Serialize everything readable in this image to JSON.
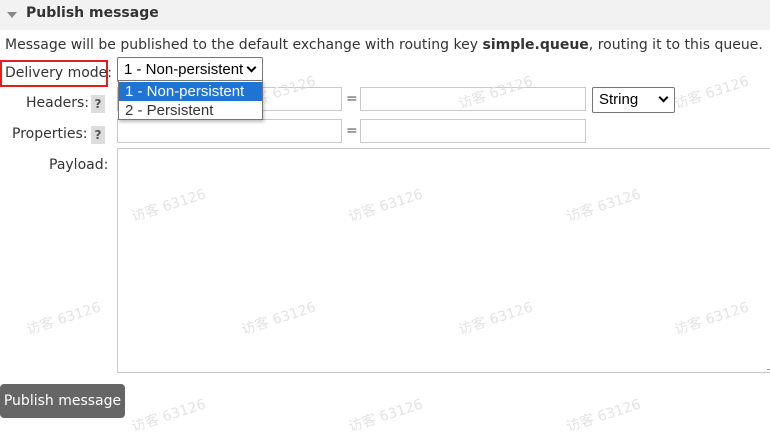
{
  "section": {
    "title": "Publish message"
  },
  "info": {
    "prefix": "Message will be published to the default exchange with routing key ",
    "routing_key": "simple.queue",
    "suffix": ", routing it to this queue."
  },
  "form": {
    "delivery_mode_label": "Delivery mode:",
    "delivery_mode_selected": "1 - Non-persistent",
    "delivery_mode_options": [
      "1 - Non-persistent",
      "2 - Persistent"
    ],
    "headers_label": "Headers:",
    "properties_label": "Properties:",
    "payload_label": "Payload:",
    "help_mark": "?",
    "equals": "=",
    "header_type_selected": "String"
  },
  "publish_button_label": "Publish message",
  "watermark": "访客 63126"
}
